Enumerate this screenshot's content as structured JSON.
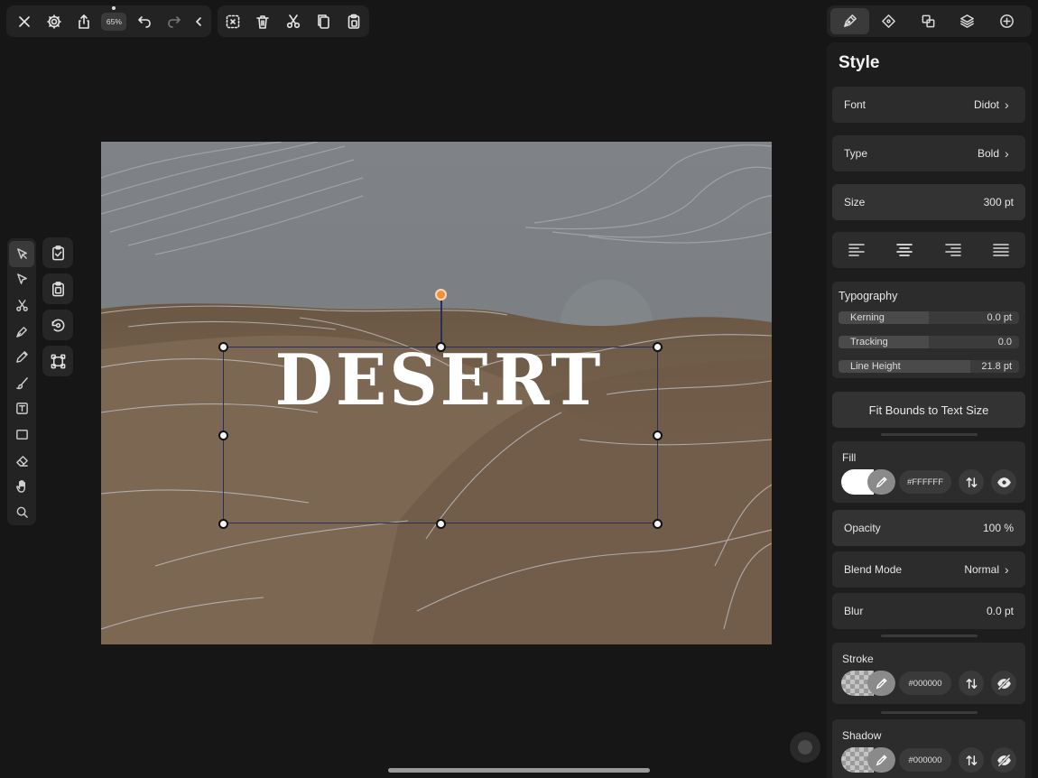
{
  "toolbar": {
    "zoom": "65%",
    "buttons_left": [
      "close-icon",
      "gear-icon",
      "share-icon",
      "zoom-badge",
      "undo-icon",
      "redo-icon",
      "collapse-icon"
    ],
    "buttons_right": [
      "deselect-icon",
      "trash-icon",
      "scissors-icon",
      "copy-icon",
      "paste-icon"
    ]
  },
  "left_tools": [
    "select-arrow-icon",
    "node-arrow-icon",
    "scissors-icon",
    "pen-icon",
    "pencil-icon",
    "brush-icon",
    "text-tool-icon",
    "rectangle-icon",
    "eraser-icon",
    "hand-icon",
    "zoom-icon"
  ],
  "quick_actions": [
    "checklist-icon",
    "clipboard-icon",
    "rotate-icon",
    "transform-icon"
  ],
  "canvas": {
    "text": "DESERT",
    "text_color": "#FFFFFF",
    "accent": "#F0913A"
  },
  "inspector_tabs": [
    "style-brush-icon",
    "node-diamond-icon",
    "boolean-icon",
    "layers-icon",
    "add-icon"
  ],
  "panel": {
    "title": "Style",
    "font": {
      "label": "Font",
      "value": "Didot"
    },
    "type": {
      "label": "Type",
      "value": "Bold"
    },
    "size": {
      "label": "Size",
      "value": "300 pt"
    },
    "alignment": [
      "align-left-icon",
      "align-center-icon",
      "align-right-icon",
      "align-justify-icon"
    ],
    "typography": {
      "title": "Typography",
      "kerning": {
        "label": "Kerning",
        "value": "0.0 pt",
        "fill": 0.5
      },
      "tracking": {
        "label": "Tracking",
        "value": "0.0",
        "fill": 0.5
      },
      "line_height": {
        "label": "Line Height",
        "value": "21.8 pt",
        "fill": 0.73
      }
    },
    "fit_bounds": "Fit Bounds to Text Size",
    "fill": {
      "title": "Fill",
      "hex": "#FFFFFF"
    },
    "opacity": {
      "label": "Opacity",
      "value": "100 %"
    },
    "blend_mode": {
      "label": "Blend Mode",
      "value": "Normal"
    },
    "blur": {
      "label": "Blur",
      "value": "0.0 pt"
    },
    "stroke": {
      "title": "Stroke",
      "hex": "#000000"
    },
    "shadow": {
      "title": "Shadow",
      "hex": "#000000"
    }
  }
}
